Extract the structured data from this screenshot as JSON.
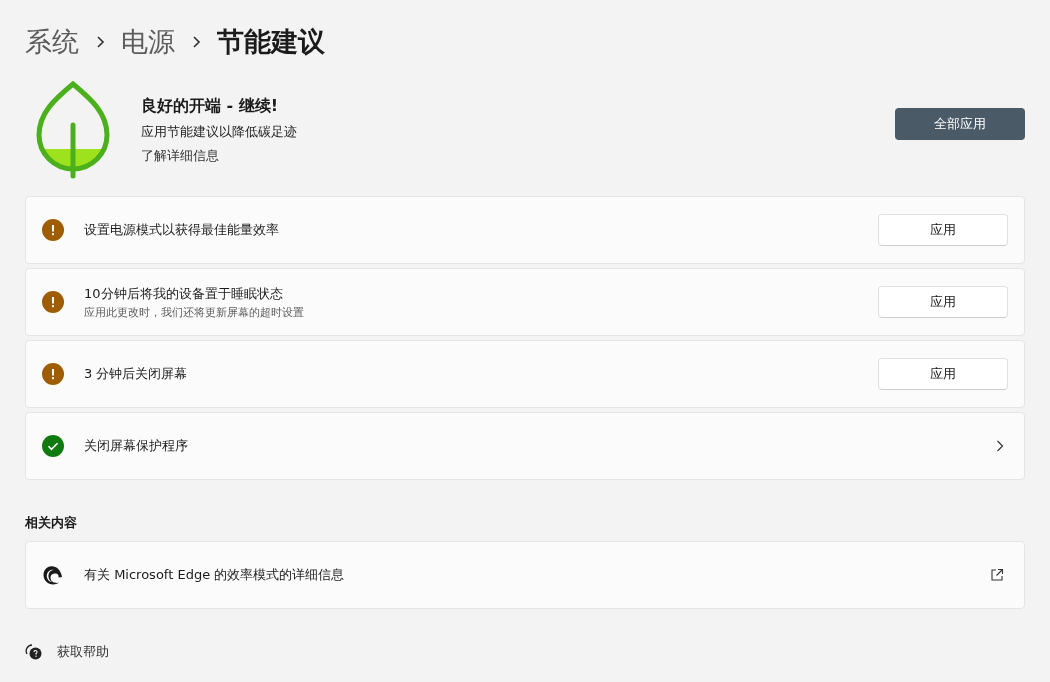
{
  "breadcrumb": [
    {
      "label": "系统",
      "current": false
    },
    {
      "label": "电源",
      "current": false
    },
    {
      "label": "节能建议",
      "current": true
    }
  ],
  "summary": {
    "title": "良好的开端 - 继续!",
    "subtitle": "应用节能建议以降低碳足迹",
    "link": "了解详细信息",
    "button": "全部应用"
  },
  "recommendations": [
    {
      "done": false,
      "title": "设置电源模式以获得最佳能量效率",
      "kind": "button",
      "action": "应用"
    },
    {
      "done": false,
      "title": "10分钟后将我的设备置于睡眠状态",
      "description": "应用此更改时，我们还将更新屏幕的超时设置",
      "kind": "button",
      "action": "应用"
    },
    {
      "done": false,
      "title": "3 分钟后关闭屏幕",
      "kind": "button",
      "action": "应用"
    },
    {
      "done": true,
      "title": "关闭屏幕保护程序",
      "kind": "link"
    }
  ],
  "related": {
    "heading": "相关内容",
    "items": [
      {
        "title": "有关 Microsoft Edge 的效率模式的详细信息"
      }
    ]
  },
  "help": {
    "label": "获取帮助"
  }
}
